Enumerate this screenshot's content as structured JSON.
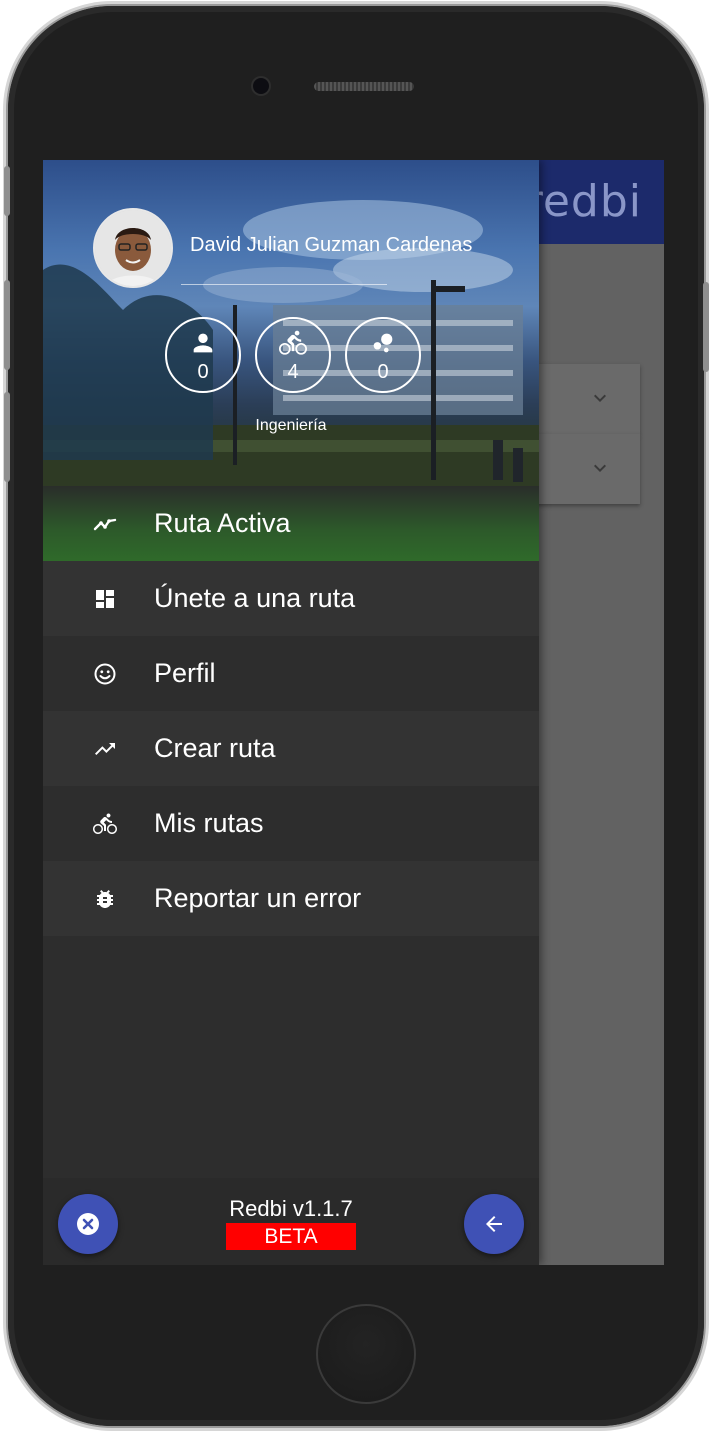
{
  "app": {
    "logo": "redbi"
  },
  "drawer": {
    "user_name": "David Julian Guzman Cardenas",
    "faculty": "Ingeniería",
    "stats": [
      {
        "icon": "person-icon",
        "value": "0"
      },
      {
        "icon": "bike-icon",
        "value": "4"
      },
      {
        "icon": "bubble-chart-icon",
        "value": "0"
      }
    ],
    "menu": [
      {
        "label": "Ruta Activa",
        "icon": "timeline-icon",
        "active": true,
        "accent": "#2f6a2a"
      },
      {
        "label": "Únete a una ruta",
        "icon": "dashboard-icon"
      },
      {
        "label": "Perfil",
        "icon": "smiley-icon"
      },
      {
        "label": "Crear ruta",
        "icon": "trending-up-icon"
      },
      {
        "label": "Mis rutas",
        "icon": "bike-icon"
      },
      {
        "label": "Reportar un error",
        "icon": "bug-icon"
      }
    ],
    "footer": {
      "version": "Redbi v1.1.7",
      "badge": "BETA",
      "badge_color": "#ff0000",
      "fab_color": "#3f51b5"
    }
  }
}
